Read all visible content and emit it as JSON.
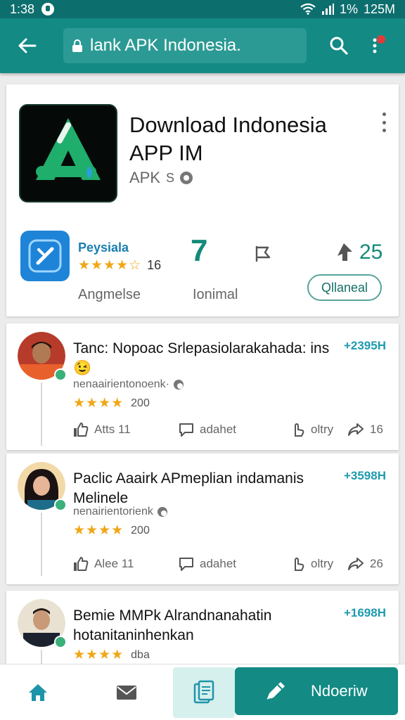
{
  "status_bar": {
    "time": "1:38",
    "battery": "1%",
    "data_rate": "125M"
  },
  "app_bar": {
    "url_text": "lank APK Indonesia."
  },
  "app": {
    "title": "Download Indonesia APP IM",
    "subtitle": "APK",
    "subtitle_tag": "S",
    "developer_name": "Peysiala",
    "developer_rating_count": "16",
    "developer_label": "Angmelse",
    "stat_value": "7",
    "stat_label": "Ionimal",
    "upvote_count": "25",
    "download_label": "Qllaneal"
  },
  "reviews": [
    {
      "title": "Tanc: Nopoac Srlepasiolarakahada: ins 😉",
      "score": "+2395H",
      "author": "nenaairientonoenk·",
      "rating_count": "200",
      "likes_label": "Atts 11",
      "reply_label": "adahet",
      "share_label": "oltry",
      "forward_count": "16"
    },
    {
      "title": "Paclic Aaairk APmeplian indamanis Melinele",
      "score": "+3598H",
      "author": "nenairientorienk",
      "rating_count": "200",
      "likes_label": "Alee 11",
      "reply_label": "adahet",
      "share_label": "oltry",
      "forward_count": "26"
    },
    {
      "title": "Bemie MMPk Alrandnanahatin hotanitaninhenkan",
      "score": "+1698H",
      "rating_count": "dba"
    }
  ],
  "bottom_nav": {
    "review_label": "Ndoeriw"
  },
  "colors": {
    "primary": "#138a84",
    "accent": "#148a7a",
    "star": "#f0a716",
    "score": "#1e9bb0"
  }
}
